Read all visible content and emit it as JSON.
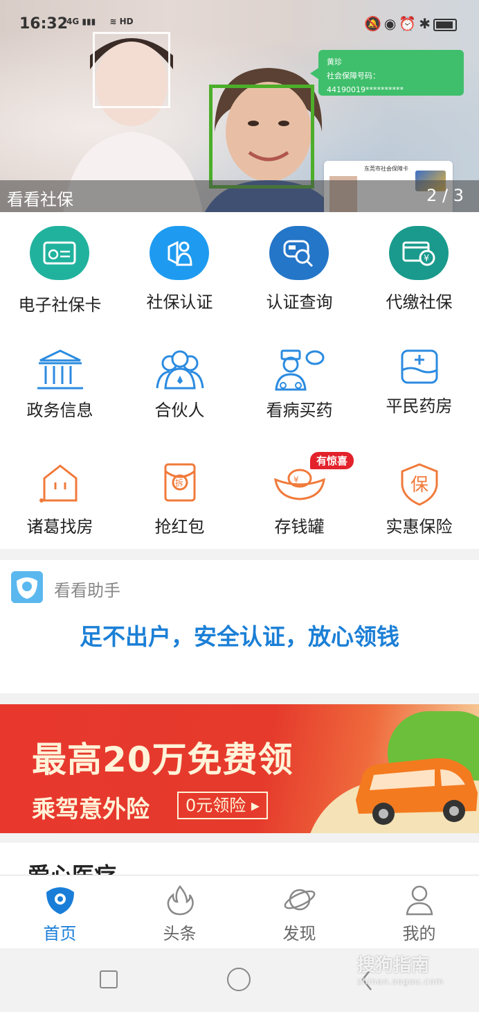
{
  "status_bar": {
    "time": "16:32",
    "network": "4G",
    "network2": "HD"
  },
  "hero": {
    "caption": "看看社保",
    "pager": "2 / 3",
    "bubble_name": "黄珍",
    "bubble_id": "社会保障号码：44190019**********",
    "card_title": "东莞市社会保障卡"
  },
  "services": [
    {
      "label": "电子社保卡",
      "icon": "social-card-icon"
    },
    {
      "label": "社保认证",
      "icon": "shield-person-icon"
    },
    {
      "label": "认证查询",
      "icon": "search-card-icon"
    },
    {
      "label": "代缴社保",
      "icon": "payment-card-icon"
    },
    {
      "label": "政务信息",
      "icon": "government-building-icon"
    },
    {
      "label": "合伙人",
      "icon": "partners-icon"
    },
    {
      "label": "看病买药",
      "icon": "doctor-icon"
    },
    {
      "label": "平民药房",
      "icon": "pharmacy-icon"
    },
    {
      "label": "诸葛找房",
      "icon": "house-icon"
    },
    {
      "label": "抢红包",
      "icon": "red-envelope-icon"
    },
    {
      "label": "存钱罐",
      "icon": "gold-ingot-icon"
    },
    {
      "label": "实惠保险",
      "icon": "insurance-shield-icon"
    }
  ],
  "piggy_badge": "有惊喜",
  "assistant": {
    "name": "看看助手",
    "slogan": "足不出户，安全认证，放心领钱"
  },
  "ad": {
    "line1": "最高20万免费领",
    "line2": "乘驾意外险",
    "button": "0元领险 ▸"
  },
  "section": {
    "title": "爱心医疗"
  },
  "tabs": [
    {
      "label": "首页",
      "icon": "home-icon",
      "active": true
    },
    {
      "label": "头条",
      "icon": "flame-icon",
      "active": false
    },
    {
      "label": "发现",
      "icon": "planet-icon",
      "active": false
    },
    {
      "label": "我的",
      "icon": "profile-icon",
      "active": false
    }
  ],
  "watermark": {
    "text": "搜狗指南",
    "sub": "zhinan.sogou.com"
  },
  "colors": {
    "primary": "#1a7ed8",
    "teal": "#1fae9b",
    "blue": "#2196f3",
    "orange": "#f07a3a",
    "red": "#e3222b"
  }
}
